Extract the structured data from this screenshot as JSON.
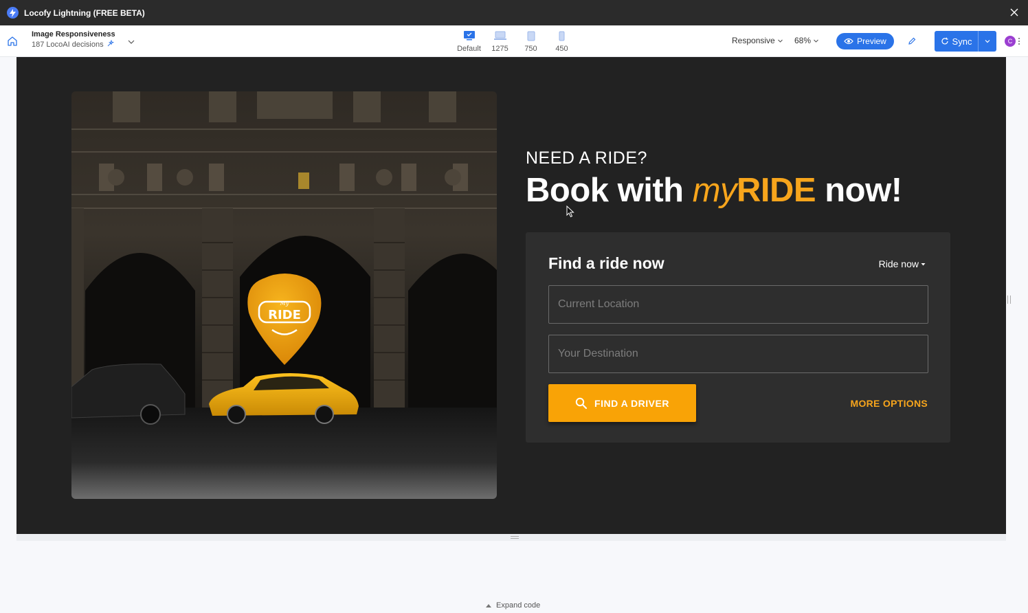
{
  "app": {
    "title": "Locofy Lightning (FREE BETA)"
  },
  "toolbar": {
    "project_name": "Image Responsiveness",
    "project_sub": "187 LocoAI decisions",
    "breakpoints": [
      {
        "label": "Default",
        "icon": "desktop-icon"
      },
      {
        "label": "1275",
        "icon": "laptop-icon"
      },
      {
        "label": "750",
        "icon": "tablet-icon"
      },
      {
        "label": "450",
        "icon": "mobile-icon"
      }
    ],
    "responsive_label": "Responsive",
    "zoom_label": "68%",
    "preview_label": "Preview",
    "sync_label": "Sync",
    "avatar_initial": "C"
  },
  "hero": {
    "need": "NEED A RIDE?",
    "headline_prefix": "Book with ",
    "headline_my": "my",
    "headline_ride": "RIDE",
    "headline_suffix": " now!"
  },
  "card": {
    "title": "Find a ride now",
    "ride_mode": "Ride now",
    "location_placeholder": "Current Location",
    "destination_placeholder": "Your Destination",
    "find_label": "FIND A DRIVER",
    "more_label": "MORE OPTIONS"
  },
  "photo": {
    "logo_small": "My",
    "logo_text": "RIDE"
  },
  "footer": {
    "expand_label": "Expand code"
  },
  "colors": {
    "accent": "#f7a51c",
    "button": "#f9a306",
    "primary_blue": "#2a73e8",
    "canvas_bg": "#222222",
    "card_bg": "#2e2e2e"
  }
}
